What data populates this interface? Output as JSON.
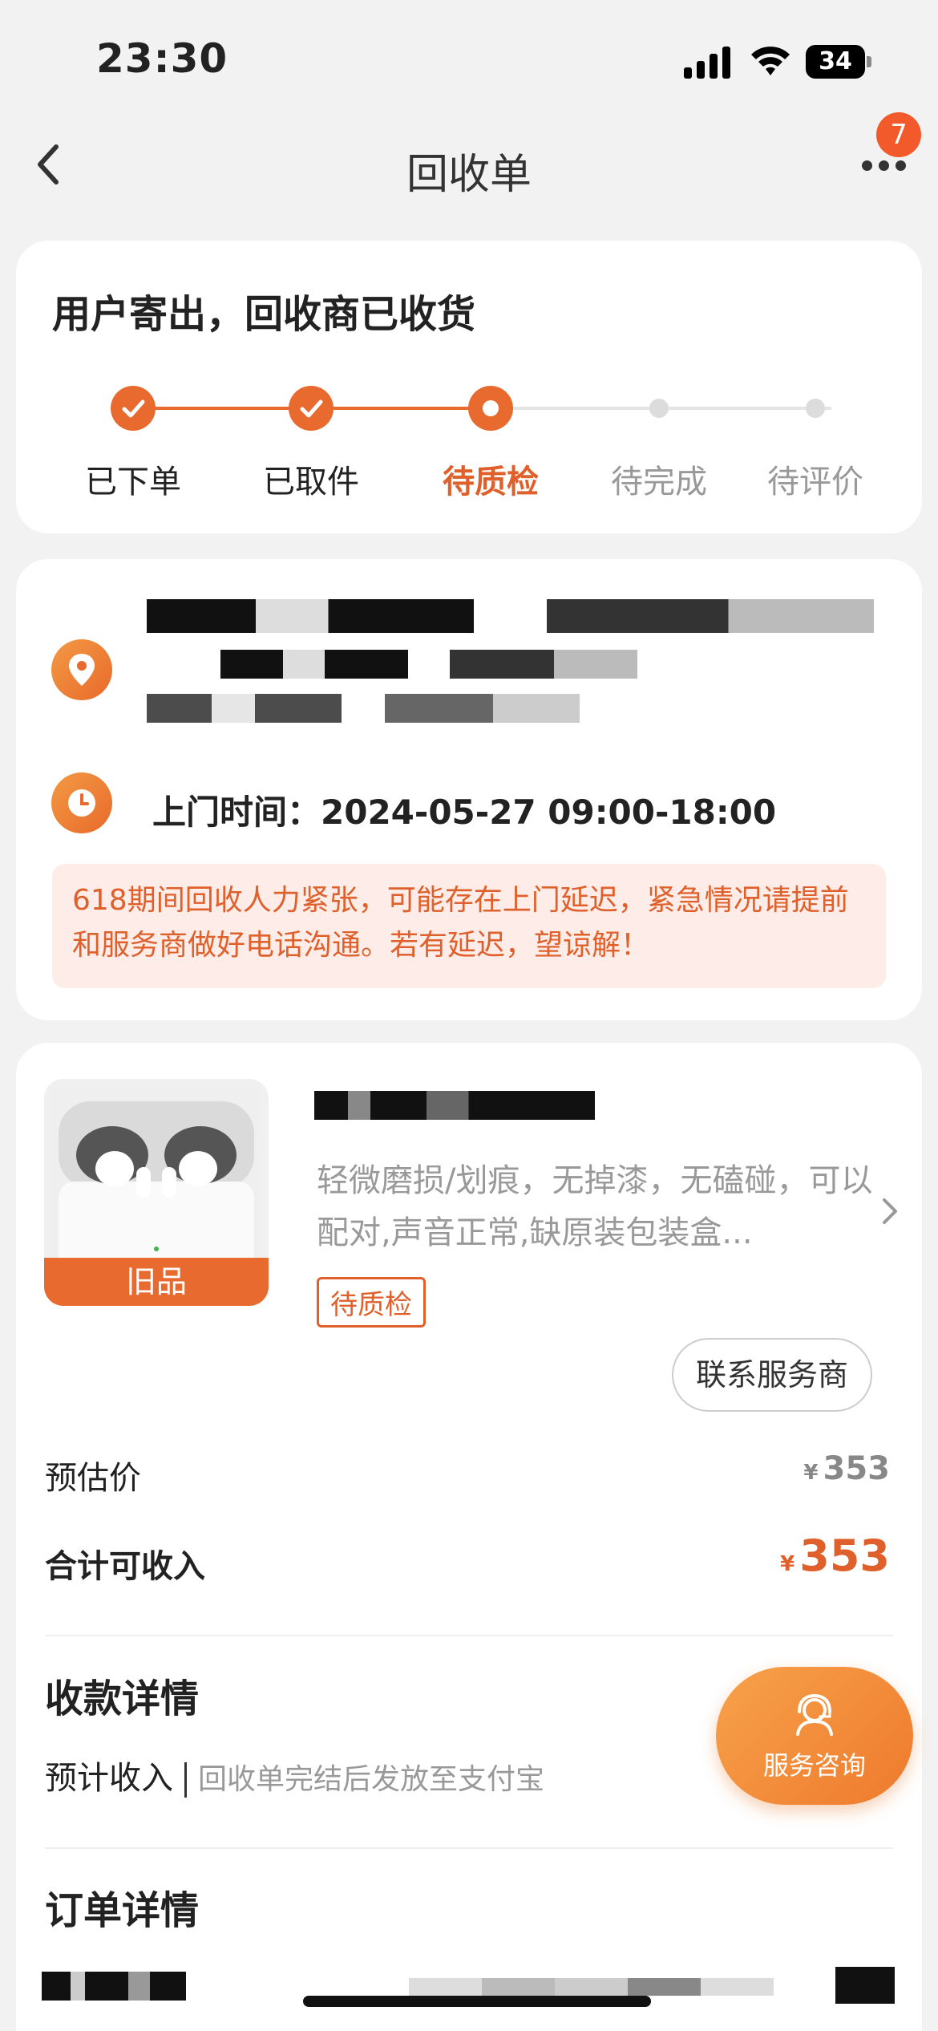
{
  "status_bar": {
    "time": "23:30",
    "battery": "34"
  },
  "nav": {
    "title": "回收单",
    "badge_count": "7"
  },
  "progress": {
    "title": "用户寄出，回收商已收货",
    "steps": [
      {
        "label": "已下单",
        "state": "done"
      },
      {
        "label": "已取件",
        "state": "done"
      },
      {
        "label": "待质检",
        "state": "current"
      },
      {
        "label": "待完成",
        "state": "pending"
      },
      {
        "label": "待评价",
        "state": "pending"
      }
    ]
  },
  "pickup": {
    "time_label": "上门时间：2024-05-27 09:00-18:00",
    "notice": "618期间回收人力紧张，可能存在上门延迟，紧急情况请提前和服务商做好电话沟通。若有延迟，望谅解！"
  },
  "product": {
    "condition_tag": "旧品",
    "description": "轻微磨损/划痕，无掉漆，无磕碰，可以配对,声音正常,缺原装包装盒...",
    "status_tag": "待质检",
    "contact_button": "联系服务商"
  },
  "pricing": {
    "estimate_label": "预估价",
    "estimate_value": "353",
    "total_label": "合计可收入",
    "total_value": "353",
    "currency": "¥"
  },
  "payment": {
    "title": "收款详情",
    "expected_label": "预计收入",
    "expected_note": "回收单完结后发放至支付宝"
  },
  "order": {
    "title": "订单详情"
  },
  "fab": {
    "label": "服务咨询"
  },
  "colors": {
    "accent": "#e96a2f",
    "notice_bg": "#fdece7"
  }
}
